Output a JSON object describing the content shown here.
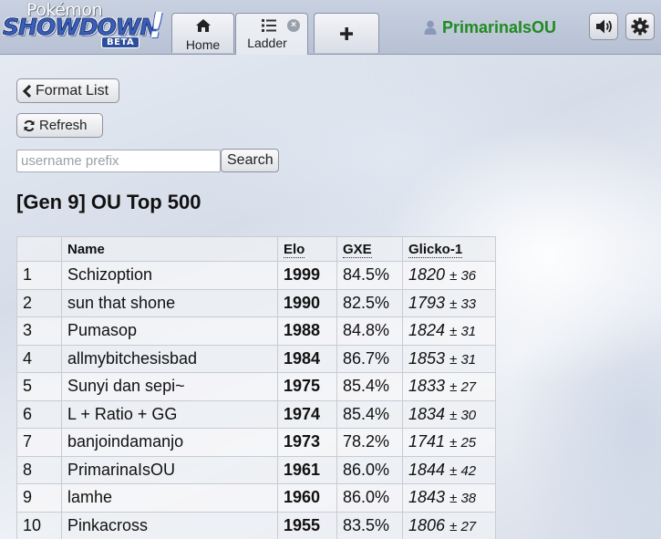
{
  "header": {
    "logo": {
      "line1": "Pokémon",
      "line2": "SHOWDOWN",
      "bang": "!",
      "badge": "BETA"
    },
    "tabs": [
      {
        "label": "Home",
        "icon": "home-icon"
      },
      {
        "label": "Ladder",
        "icon": "list-icon",
        "closable": true
      },
      {
        "label": "+",
        "icon": "plus-icon"
      }
    ],
    "username": "PrimarinaIsOU",
    "user_icon": "user-icon",
    "buttons": [
      {
        "icon": "speaker-icon"
      },
      {
        "icon": "gear-icon"
      }
    ]
  },
  "controls": {
    "format_list_label": "Format List",
    "refresh_label": "Refresh",
    "search_placeholder": "username prefix",
    "search_value": "",
    "search_label": "Search"
  },
  "ladder": {
    "title": "[Gen 9] OU Top 500",
    "columns": [
      "",
      "Name",
      "Elo",
      "GXE",
      "Glicko-1"
    ],
    "rows": [
      {
        "rank": "1",
        "name": "Schizoption",
        "elo": "1999",
        "gxe": "84.5%",
        "glicko": "1820",
        "dev": "± 36"
      },
      {
        "rank": "2",
        "name": "sun that shone",
        "elo": "1990",
        "gxe": "82.5%",
        "glicko": "1793",
        "dev": "± 33"
      },
      {
        "rank": "3",
        "name": "Pumasop",
        "elo": "1988",
        "gxe": "84.8%",
        "glicko": "1824",
        "dev": "± 31"
      },
      {
        "rank": "4",
        "name": "allmybitchesisbad",
        "elo": "1984",
        "gxe": "86.7%",
        "glicko": "1853",
        "dev": "± 31"
      },
      {
        "rank": "5",
        "name": "Sunyi dan sepi~",
        "elo": "1975",
        "gxe": "85.4%",
        "glicko": "1833",
        "dev": "± 27"
      },
      {
        "rank": "6",
        "name": "L + Ratio + GG",
        "elo": "1974",
        "gxe": "85.4%",
        "glicko": "1834",
        "dev": "± 30"
      },
      {
        "rank": "7",
        "name": "banjoindamanjo",
        "elo": "1973",
        "gxe": "78.2%",
        "glicko": "1741",
        "dev": "± 25"
      },
      {
        "rank": "8",
        "name": "PrimarinaIsOU",
        "elo": "1961",
        "gxe": "86.0%",
        "glicko": "1844",
        "dev": "± 42"
      },
      {
        "rank": "9",
        "name": "lamhe",
        "elo": "1960",
        "gxe": "86.0%",
        "glicko": "1843",
        "dev": "± 38"
      },
      {
        "rank": "10",
        "name": "Pinkacross",
        "elo": "1955",
        "gxe": "83.5%",
        "glicko": "1806",
        "dev": "± 27"
      }
    ]
  }
}
